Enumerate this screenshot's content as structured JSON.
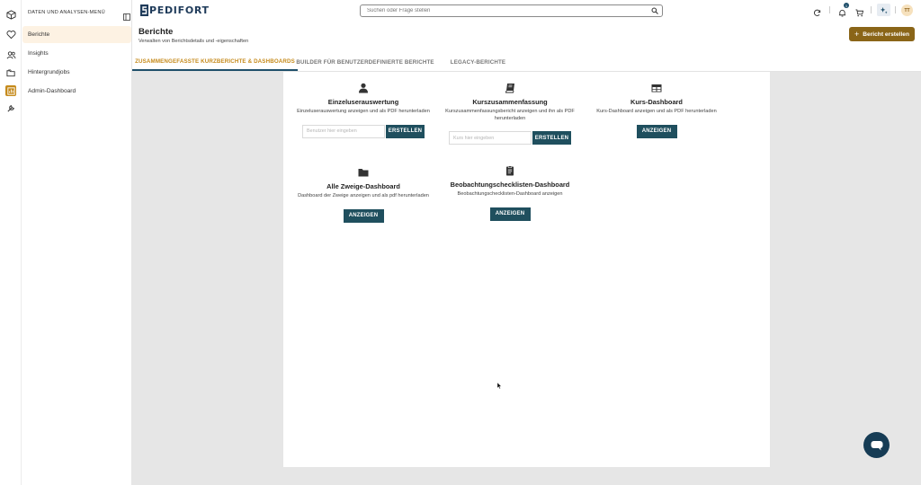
{
  "rail": {
    "icons": [
      "cube-icon",
      "heart-icon",
      "users-icon",
      "folders-icon",
      "reports-icon",
      "wrench-icon"
    ],
    "active_color": "#c58a1b"
  },
  "sidebar": {
    "title": "DATEN UND ANALYSEN-MENÜ",
    "items": [
      {
        "label": "Berichte",
        "active": true
      },
      {
        "label": "Insights",
        "active": false
      },
      {
        "label": "Hintergrundjobs",
        "active": false
      },
      {
        "label": "Admin-Dashboard",
        "active": false
      }
    ]
  },
  "header": {
    "logo_text": "PEDIFORT",
    "logo_mark_color": "#1f3b5a",
    "search_placeholder": "Suchen oder Frage stellen",
    "notification_count": "1",
    "avatar_initials": "TT",
    "page_title": "Berichte",
    "page_subtitle": "Verwalten von Berichtsdetails und -eigenschaften",
    "create_button": "Bericht erstellen",
    "create_button_color": "#8a6518"
  },
  "tabs": [
    {
      "label": "ZUSAMMENGEFASSTE KURZBERICHTE & DASHBOARDS",
      "active": true
    },
    {
      "label": "BUILDER FÜR BENUTZERDEFINIERTE BERICHTE",
      "active": false
    },
    {
      "label": "LEGACY-BERICHTE",
      "active": false
    }
  ],
  "cards": {
    "einzel": {
      "icon": "user-icon",
      "title": "Einzeluserauswertung",
      "description": "Einzeluserauswertung anzeigen und als PDF herunterladen",
      "input_placeholder": "Benutzer hier eingeben",
      "button": "ERSTELLEN"
    },
    "kurszus": {
      "icon": "book-icon",
      "title": "Kurszusammenfassung",
      "description": "Kurszusammenfassungsbericht anzeigen und ihn als PDF herunterladen",
      "input_placeholder": "Kurs hier eingeben",
      "button": "ERSTELLEN"
    },
    "kursdash": {
      "icon": "table-icon",
      "title": "Kurs-Dashboard",
      "description": "Kurs-Dashboard anzeigen und als PDF herunterladen",
      "button": "ANZEIGEN"
    },
    "zweige": {
      "icon": "folder-icon",
      "title": "Alle Zweige-Dashboard",
      "description": "Dashboard der Zweige anzeigen und als pdf herunterladen",
      "button": "ANZEIGEN"
    },
    "beob": {
      "icon": "clipboard-icon",
      "title": "Beobachtungschecklisten-Dashboard",
      "description": "Beobachtungschecklisten-Dashboard anzeigen",
      "button": "ANZEIGEN"
    }
  },
  "colors": {
    "primary_dark": "#1f4f5e",
    "accent": "#c58a1b",
    "content_bg": "#e6e6e6",
    "chat_button": "#163c55"
  }
}
